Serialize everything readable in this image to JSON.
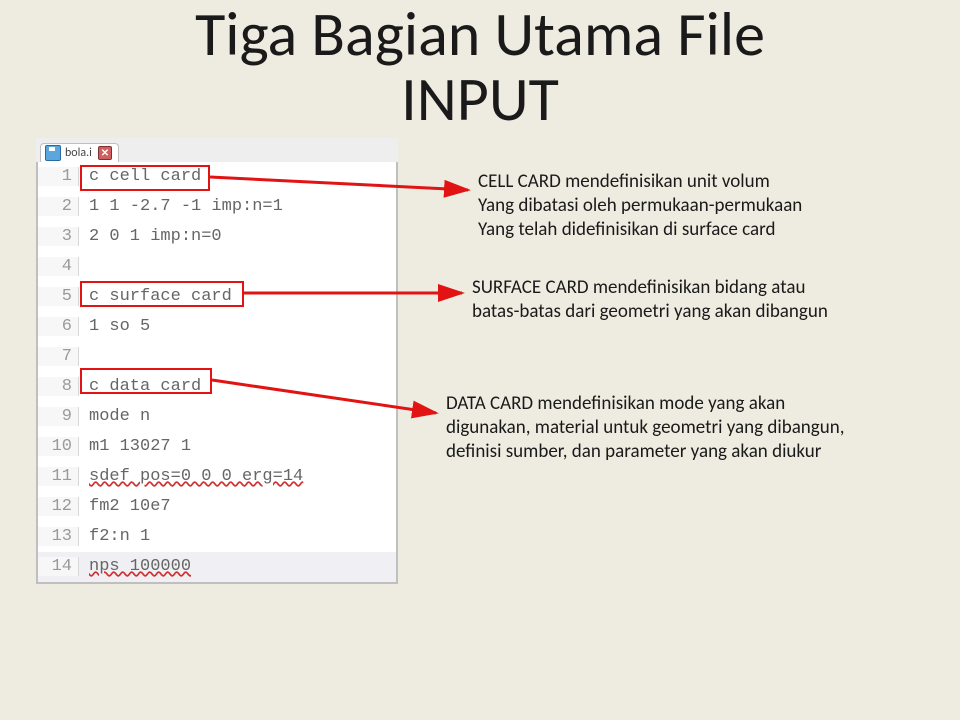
{
  "title_line1": "Tiga Bagian Utama File",
  "title_line2": "INPUT",
  "tab": {
    "filename": "bola.i",
    "close_glyph": "✕"
  },
  "code": {
    "lines": [
      {
        "n": "1",
        "t": "c cell card",
        "hl": true,
        "wavy": false
      },
      {
        "n": "2",
        "t": "1 1 -2.7 -1 imp:n=1",
        "hl": false,
        "wavy": false
      },
      {
        "n": "3",
        "t": "2 0 1 imp:n=0",
        "hl": false,
        "wavy": false
      },
      {
        "n": "4",
        "t": "",
        "hl": false,
        "wavy": false
      },
      {
        "n": "5",
        "t": "c surface card",
        "hl": true,
        "wavy": false
      },
      {
        "n": "6",
        "t": "1 so 5",
        "hl": false,
        "wavy": false
      },
      {
        "n": "7",
        "t": "",
        "hl": false,
        "wavy": false
      },
      {
        "n": "8",
        "t": "c data card",
        "hl": true,
        "wavy": false
      },
      {
        "n": "9",
        "t": "mode n",
        "hl": false,
        "wavy": false
      },
      {
        "n": "10",
        "t": "m1 13027 1",
        "hl": false,
        "wavy": false
      },
      {
        "n": "11",
        "t": "sdef pos=0 0 0 erg=14",
        "hl": false,
        "wavy": true
      },
      {
        "n": "12",
        "t": "fm2 10e7",
        "hl": false,
        "wavy": false
      },
      {
        "n": "13",
        "t": "f2:n 1",
        "hl": false,
        "wavy": false
      },
      {
        "n": "14",
        "t": "nps 100000",
        "hl": false,
        "wavy": true
      }
    ]
  },
  "anno": {
    "cell": {
      "l1": "CELL CARD mendefinisikan unit volum",
      "l2": "Yang dibatasi oleh permukaan-permukaan",
      "l3": "Yang telah didefinisikan di surface card"
    },
    "surface": {
      "l1": "SURFACE CARD mendefinisikan bidang atau",
      "l2": "batas-batas dari geometri yang akan dibangun"
    },
    "data": {
      "l1": "DATA CARD mendefinisikan mode yang akan",
      "l2": "digunakan, material untuk geometri yang dibangun,",
      "l3": "definisi sumber, dan parameter yang akan diukur"
    }
  },
  "colors": {
    "hl": "#e11313"
  }
}
